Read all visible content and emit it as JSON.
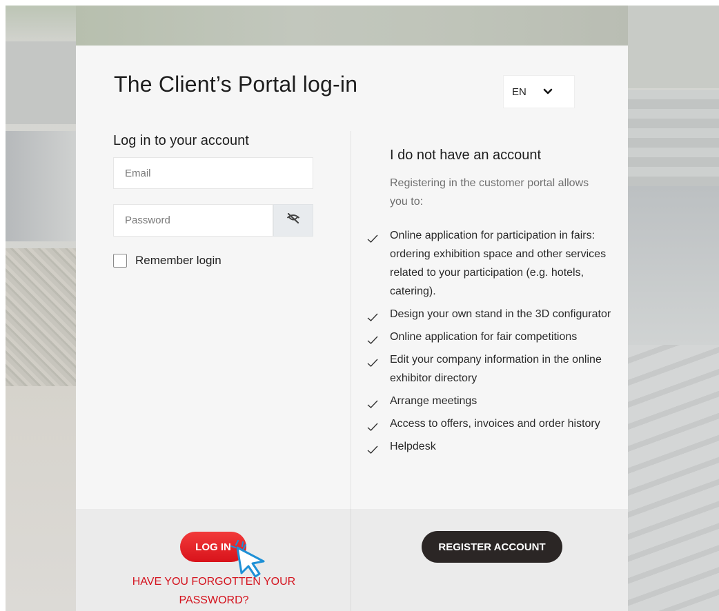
{
  "page": {
    "title": "The Client’s Portal log-in",
    "language": {
      "selected": "EN"
    }
  },
  "login": {
    "heading": "Log in to your account",
    "email_placeholder": "Email",
    "email_value": "",
    "password_placeholder": "Password",
    "password_value": "",
    "remember_label": "Remember login",
    "remember_checked": false,
    "login_button": "LOG IN",
    "forgot_link": "HAVE YOU FORGOTTEN YOUR PASSWORD?"
  },
  "register": {
    "heading": "I do not have an account",
    "intro": "Registering in the customer portal allows you to:",
    "features": [
      "Online application for participation in fairs: ordering exhibition space and other services related to your participation (e.g. hotels, catering).",
      "Design your own stand in the 3D configurator",
      "Online application for fair competitions",
      "Edit your company information in the online exhibitor directory",
      "Arrange meetings",
      "Access to offers, invoices and order history",
      "Helpdesk"
    ],
    "register_button": "REGISTER ACCOUNT"
  },
  "icons": {
    "language_dropdown": "chevron-down-icon",
    "password_toggle": "eye-slash-icon",
    "feature_bullet": "check-icon",
    "pointer": "cursor-pointer-icon"
  },
  "colors": {
    "primary_red": "#e01b22",
    "link_red": "#d4121d",
    "dark_button": "#2b2625",
    "card_background": "#f6f6f6",
    "footer_background": "#ebebeb",
    "cursor_blue": "#1e90d6"
  }
}
